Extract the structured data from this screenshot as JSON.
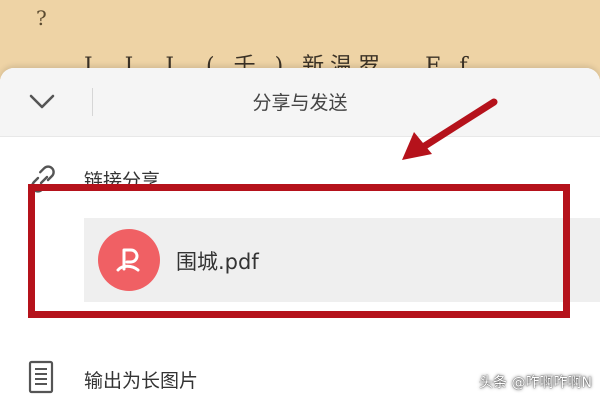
{
  "document": {
    "question_mark": "?",
    "partial_line": "I. I. I. ( 千 ) 新温罗 . F f"
  },
  "sheet": {
    "title": "分享与发送",
    "link_share_label": "链接分享",
    "file": {
      "name": "围城.pdf",
      "icon": "pdf-icon"
    },
    "export_long_image_label": "输出为长图片"
  },
  "watermark": {
    "text": "头条 @咋啊咋啊N"
  },
  "colors": {
    "document_bg": "#eed3a5",
    "highlight": "#b5121b",
    "pdf_badge": "#f06064"
  }
}
